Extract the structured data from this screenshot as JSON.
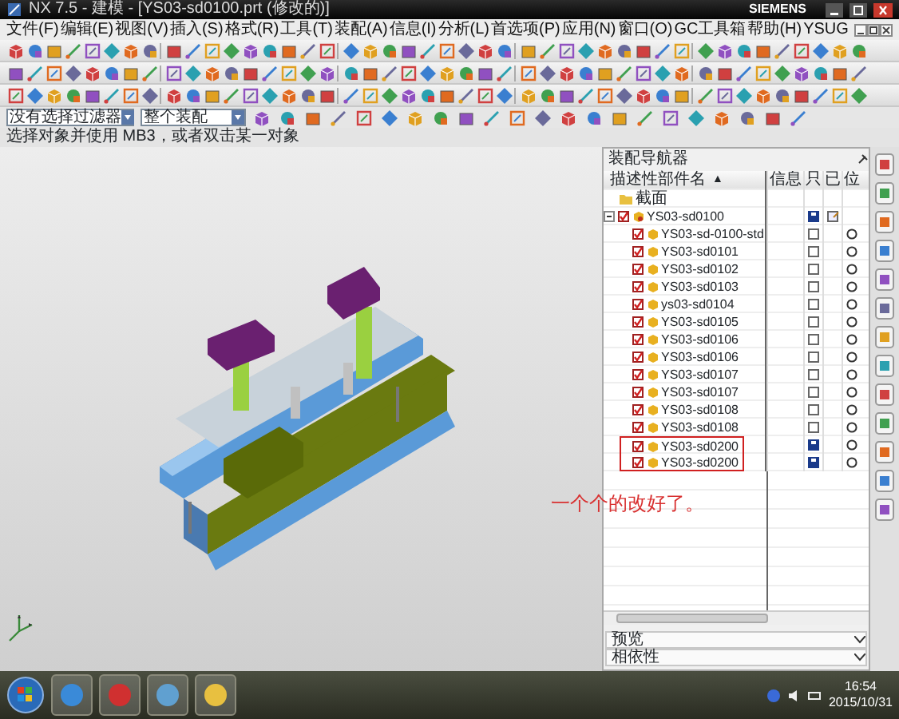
{
  "window": {
    "title": "NX 7.5 - 建模 - [YS03-sd0100.prt (修改的)]",
    "brand": "SIEMENS"
  },
  "menu": [
    "文件(F)",
    "编辑(E)",
    "视图(V)",
    "插入(S)",
    "格式(R)",
    "工具(T)",
    "装配(A)",
    "信息(I)",
    "分析(L)",
    "首选项(P)",
    "应用(N)",
    "窗口(O)",
    "GC工具箱",
    "帮助(H)",
    "YSUG"
  ],
  "filters": [
    {
      "value": "没有选择过滤器"
    },
    {
      "value": "整个装配"
    }
  ],
  "status_prompt": "选择对象并使用 MB3，或者双击某一对象",
  "navigator": {
    "title": "装配导航器",
    "columns": [
      {
        "label": "描述性部件名",
        "sort_arrow": "▲"
      },
      {
        "label": "信息"
      },
      {
        "label": "只"
      },
      {
        "label": "已"
      },
      {
        "label": "位"
      }
    ],
    "sections_node": "截面",
    "root": {
      "name": "YS03-sd0100",
      "checked": true,
      "modified": true,
      "expanded": true,
      "children": [
        {
          "name": "YS03-sd-0100-std",
          "checked": true,
          "modified": false,
          "boxed": false
        },
        {
          "name": "YS03-sd0101",
          "checked": true,
          "modified": false,
          "boxed": false
        },
        {
          "name": "YS03-sd0102",
          "checked": true,
          "modified": false,
          "boxed": false
        },
        {
          "name": "YS03-sd0103",
          "checked": true,
          "modified": false,
          "boxed": false
        },
        {
          "name": "ys03-sd0104",
          "checked": true,
          "modified": false,
          "boxed": false
        },
        {
          "name": "YS03-sd0105",
          "checked": true,
          "modified": false,
          "boxed": false
        },
        {
          "name": "YS03-sd0106",
          "checked": true,
          "modified": false,
          "boxed": false
        },
        {
          "name": "YS03-sd0106",
          "checked": true,
          "modified": false,
          "boxed": false
        },
        {
          "name": "YS03-sd0107",
          "checked": true,
          "modified": false,
          "boxed": false
        },
        {
          "name": "YS03-sd0107",
          "checked": true,
          "modified": false,
          "boxed": false
        },
        {
          "name": "YS03-sd0108",
          "checked": true,
          "modified": false,
          "boxed": false
        },
        {
          "name": "YS03-sd0108",
          "checked": true,
          "modified": false,
          "boxed": false
        },
        {
          "name": "YS03-sd0200",
          "checked": true,
          "modified": true,
          "boxed": true
        },
        {
          "name": "YS03-sd0200",
          "checked": true,
          "modified": true,
          "boxed": true
        }
      ]
    },
    "panels": [
      {
        "label": "预览",
        "expanded": false
      },
      {
        "label": "相依性",
        "expanded": false
      }
    ]
  },
  "annotation": "一个个的改好了。",
  "taskbar": {
    "time": "16:54",
    "date": "2015/10/31"
  }
}
